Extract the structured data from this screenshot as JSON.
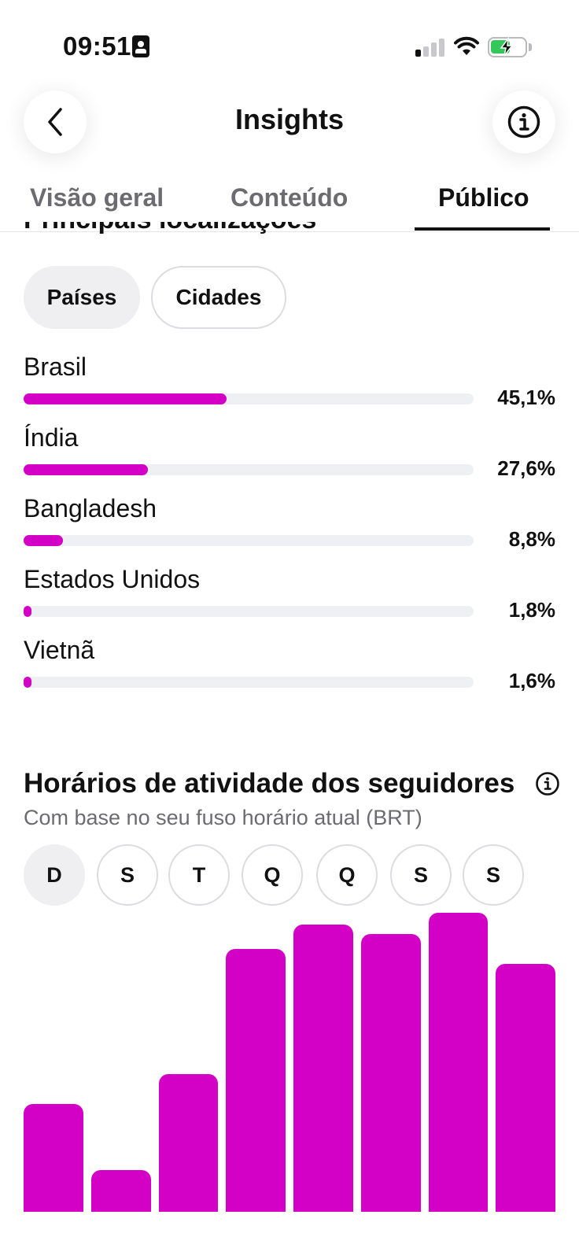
{
  "status_bar": {
    "time": "09:51"
  },
  "header": {
    "title": "Insights",
    "back_icon": "chevron-left-icon",
    "info_icon": "info-icon"
  },
  "tabs": [
    {
      "label": "Visão geral",
      "active": false
    },
    {
      "label": "Conteúdo",
      "active": false
    },
    {
      "label": "Público",
      "active": true
    }
  ],
  "locations": {
    "heading": "Principais localizações",
    "filters": [
      {
        "label": "Países",
        "active": true
      },
      {
        "label": "Cidades",
        "active": false
      }
    ],
    "countries": [
      {
        "name": "Brasil",
        "percent_label": "45,1%",
        "value": 45.1
      },
      {
        "name": "Índia",
        "percent_label": "27,6%",
        "value": 27.6
      },
      {
        "name": "Bangladesh",
        "percent_label": "8,8%",
        "value": 8.8
      },
      {
        "name": "Estados Unidos",
        "percent_label": "1,8%",
        "value": 1.8
      },
      {
        "name": "Vietnã",
        "percent_label": "1,6%",
        "value": 1.6
      }
    ],
    "bar_scale_max": 100,
    "accent_color": "#d300c5"
  },
  "activity": {
    "title": "Horários de atividade dos seguidores",
    "subtitle": "Com base no seu fuso horário atual (BRT)",
    "days": [
      {
        "label": "D",
        "active": true
      },
      {
        "label": "S",
        "active": false
      },
      {
        "label": "T",
        "active": false
      },
      {
        "label": "Q",
        "active": false
      },
      {
        "label": "Q",
        "active": false
      },
      {
        "label": "S",
        "active": false
      },
      {
        "label": "S",
        "active": false
      }
    ]
  },
  "chart_data": {
    "type": "bar",
    "title": "",
    "xlabel": "",
    "ylabel": "",
    "categories": [],
    "values": [
      36,
      14,
      46,
      88,
      96,
      93,
      100,
      83
    ],
    "ylim": [
      0,
      100
    ],
    "color": "#d300c5"
  }
}
